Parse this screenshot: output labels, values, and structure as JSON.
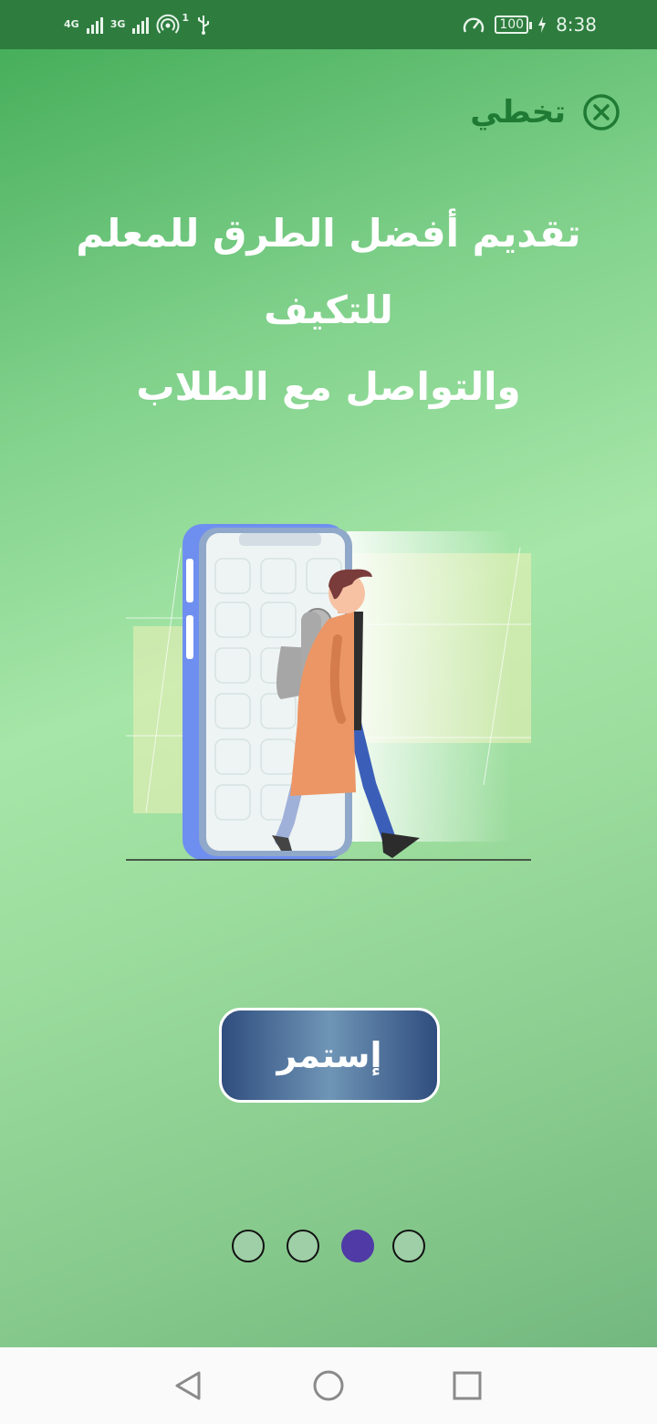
{
  "status_bar": {
    "network_1": "4G",
    "network_2": "3G",
    "hotspot_count": "1",
    "battery": "100",
    "time": "8:38"
  },
  "skip": {
    "label": "تخطي",
    "icon": "close-circle-icon"
  },
  "headline": {
    "line1": "تقديم أفضل الطرق للمعلم للتكيف",
    "line2": "والتواصل مع الطلاب"
  },
  "continue_button": {
    "label": "إستمر"
  },
  "pager": {
    "total": 4,
    "active_index": 2
  },
  "colors": {
    "accent_green": "#1f7a33",
    "button_blue": "#2f4d7e",
    "active_dot": "#4f3aa6"
  },
  "nav_bar": {
    "back_icon": "triangle-back-icon",
    "home_icon": "circle-home-icon",
    "recents_icon": "square-recents-icon"
  }
}
